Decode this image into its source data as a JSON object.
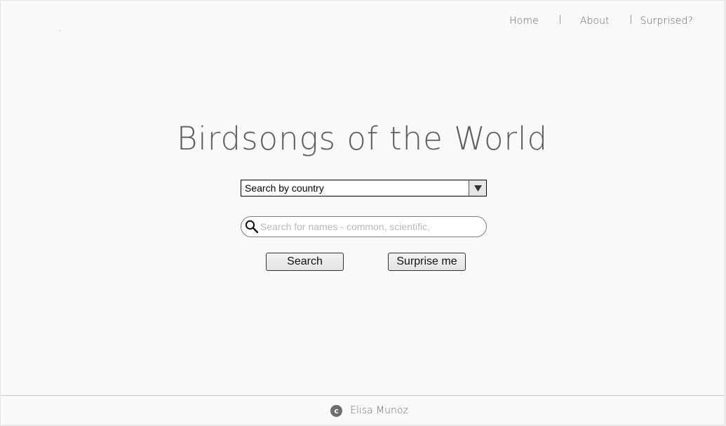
{
  "nav": {
    "items": [
      {
        "label": "Home"
      },
      {
        "label": "About"
      },
      {
        "label": "Surprised?"
      }
    ]
  },
  "main": {
    "title": "Birdsongs of the World",
    "country_select": {
      "value": "Search by country"
    },
    "search": {
      "placeholder": "Search for names - common, scientific,",
      "value": ""
    },
    "buttons": {
      "search_label": "Search",
      "surprise_label": "Surprise me"
    }
  },
  "footer": {
    "copyright_symbol": "c",
    "author": "Elisa Munoz"
  },
  "icons": {
    "search": "magnifier-icon",
    "dropdown": "triangle-down-icon",
    "copyright": "copyright-icon"
  },
  "colors": {
    "background": "#f9f9f9",
    "text_gray": "#5e5e5e",
    "nav_gray": "#666666"
  }
}
